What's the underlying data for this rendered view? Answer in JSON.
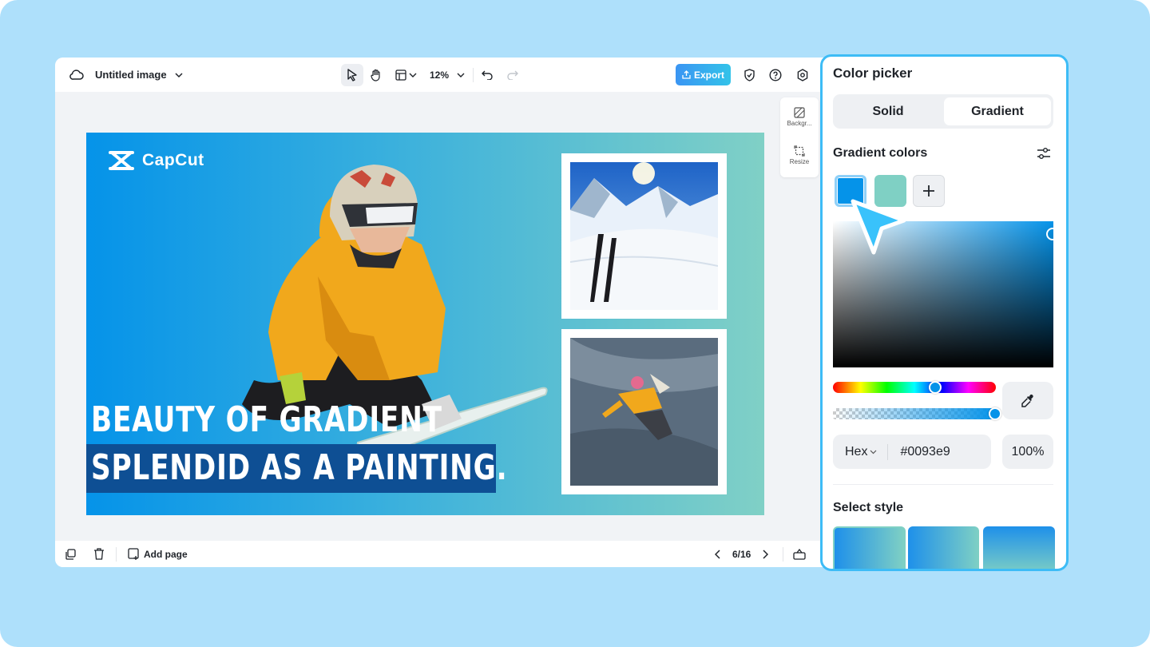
{
  "editor": {
    "doc_title": "Untitled image",
    "zoom": "12%",
    "export_label": "Export"
  },
  "canvas": {
    "logo_text": "CapCut",
    "headline_line1": "BEAUTY OF GRADIENT",
    "headline_line2": "SPLENDID AS A PAINTING."
  },
  "side_tools": {
    "background_label": "Backgr...",
    "resize_label": "Resize"
  },
  "bottom_bar": {
    "add_page_label": "Add page",
    "page_indicator": "6/16"
  },
  "color_picker": {
    "title": "Color picker",
    "tabs": [
      {
        "label": "Solid",
        "active": false
      },
      {
        "label": "Gradient",
        "active": true
      }
    ],
    "gradient_colors_title": "Gradient colors",
    "gradient_colors": [
      "#0093e9",
      "#80d0c7"
    ],
    "hex_mode": "Hex",
    "hex_value": "#0093e9",
    "opacity": "100%",
    "select_style_title": "Select style"
  },
  "colors": {
    "accent": "#3dbcf6",
    "export_start": "#3a95f3",
    "headline_band": "#0e4f94",
    "background": "#aee0fb"
  }
}
